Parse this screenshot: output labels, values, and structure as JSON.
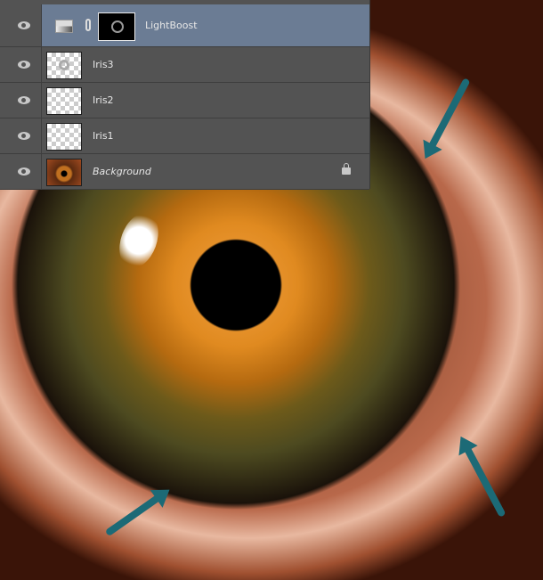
{
  "layers": [
    {
      "name": "LightBoost",
      "type": "adjustment",
      "selected": true,
      "visible": true
    },
    {
      "name": "Iris3",
      "visible": true
    },
    {
      "name": "Iris2",
      "visible": true
    },
    {
      "name": "Iris1",
      "visible": true
    },
    {
      "name": "Background",
      "visible": true,
      "locked": true
    }
  ],
  "colors": {
    "panel": "#535353",
    "selected": "#6b7c94",
    "arrow": "#1c6a76"
  },
  "icons": [
    "eye-icon",
    "levels-adjustment-icon",
    "link-icon",
    "lock-icon"
  ]
}
